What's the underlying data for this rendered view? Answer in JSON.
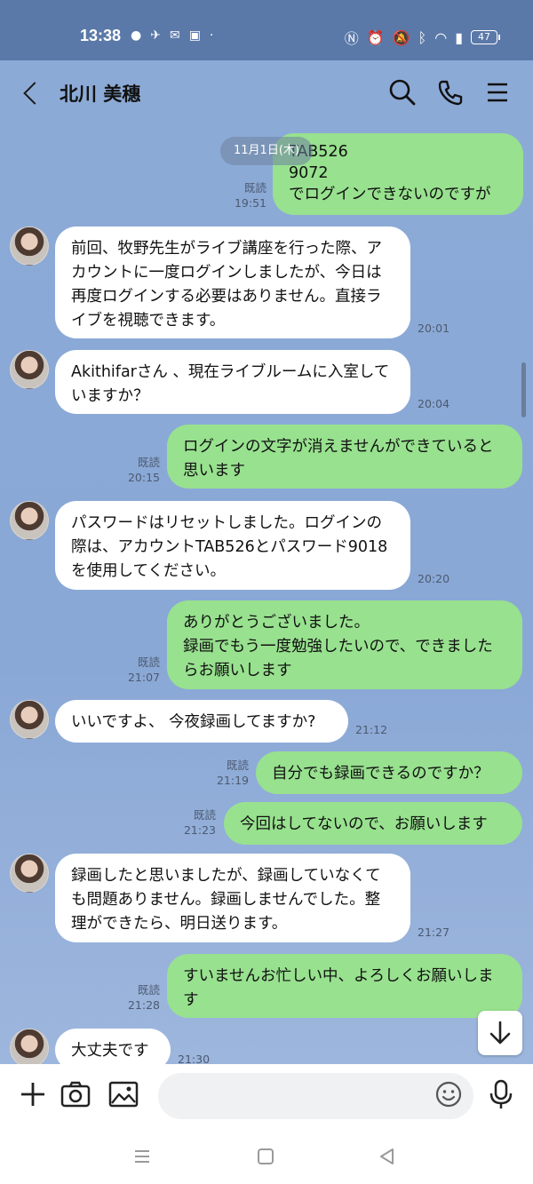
{
  "status_bar": {
    "time": "13:38",
    "battery": "47"
  },
  "header": {
    "contact_name": "北川 美穗"
  },
  "date_separator": "11月1日(木)",
  "messages": [
    {
      "side": "me",
      "text": "TAB526\n9072\nでログインできないのですが",
      "read": "既読",
      "time": "19:51"
    },
    {
      "side": "them",
      "text": "前回、牧野先生がライブ講座を行った際、アカウントに一度ログインしましたが、今日は再度ログインする必要はありません。直接ライブを視聴できます。",
      "time": "20:01"
    },
    {
      "side": "them",
      "text": "Akithifarさん 、現在ライブルームに入室していますか？",
      "time": "20:04"
    },
    {
      "side": "me",
      "text": "ログインの文字が消えませんができていると思います",
      "read": "既読",
      "time": "20:15"
    },
    {
      "side": "them",
      "text": "パスワードはリセットしました。ログインの際は、アカウントTAB526とパスワード9018を使用してください。",
      "time": "20:20"
    },
    {
      "side": "me",
      "text": "ありがとうございました。\n録画でもう一度勉強したいので、できましたらお願いします",
      "read": "既読",
      "time": "21:07"
    },
    {
      "side": "them",
      "text": "いいですよ、 今夜録画してますか?",
      "time": "21:12"
    },
    {
      "side": "me",
      "text": "自分でも録画できるのですか？",
      "read": "既読",
      "time": "21:19"
    },
    {
      "side": "me",
      "text": "今回はしてないので、お願いします",
      "read": "既読",
      "time": "21:23"
    },
    {
      "side": "them",
      "text": "録画したと思いましたが、録画していなくても問題ありません。録画しませんでした。整理ができたら、明日送ります。",
      "time": "21:27"
    },
    {
      "side": "me",
      "text": "すいませんお忙しい中、よろしくお願いします",
      "read": "既読",
      "time": "21:28"
    },
    {
      "side": "them",
      "text": "大丈夫です",
      "time": "21:30"
    }
  ],
  "input": {
    "placeholder": ""
  },
  "icons": {
    "back": "chevron-left-icon",
    "search": "search-icon",
    "call": "phone-icon",
    "menu": "hamburger-menu-icon",
    "add": "plus-icon",
    "camera": "camera-icon",
    "gallery": "image-icon",
    "emoji": "emoji-icon",
    "mic": "microphone-icon",
    "scroll_down": "chevron-down-icon"
  },
  "colors": {
    "status_bar": "#5b79a8",
    "chat_bg": "#8caad6",
    "my_bubble": "#98e18f",
    "their_bubble": "#ffffff"
  }
}
